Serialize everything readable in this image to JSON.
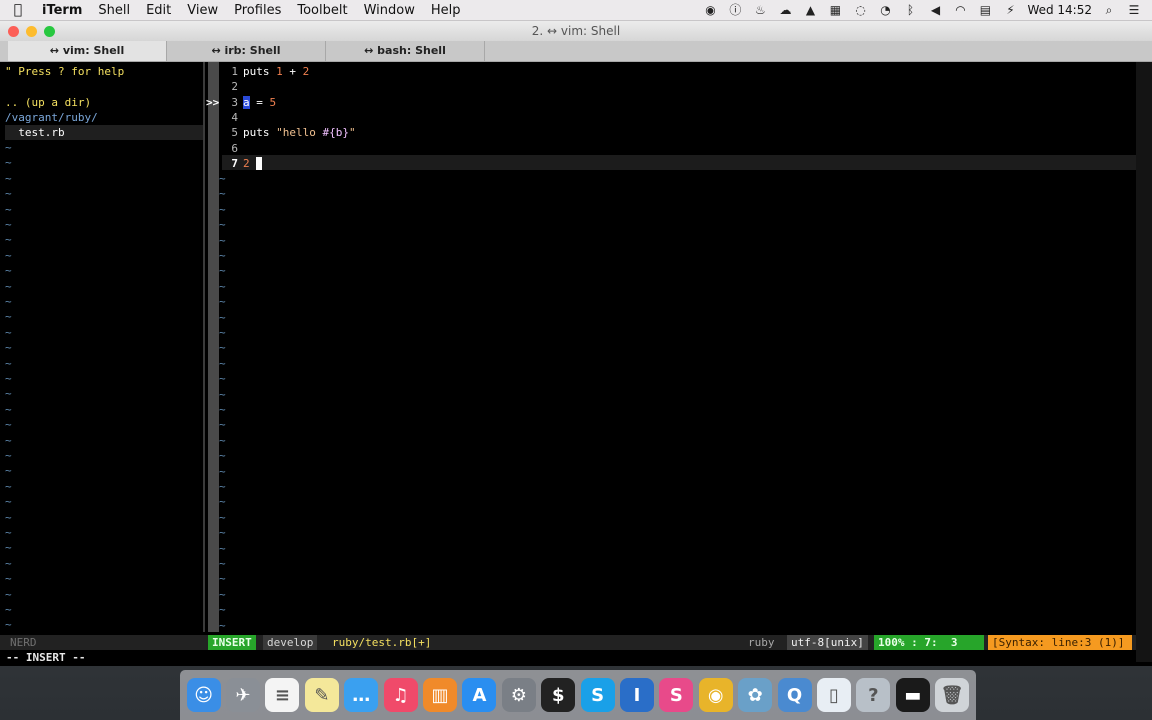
{
  "menubar": {
    "app_name": "iTerm",
    "items": [
      "Shell",
      "Edit",
      "View",
      "Profiles",
      "Toolbelt",
      "Window",
      "Help"
    ],
    "clock": "Wed 14:52",
    "battery_label": "⚡"
  },
  "window": {
    "title": "2. ↔ vim: Shell",
    "tabs": [
      {
        "label": "↔ vim: Shell"
      },
      {
        "label": "↔ irb: Shell"
      },
      {
        "label": "↔ bash: Shell"
      }
    ]
  },
  "nerdtree": {
    "help": "\" Press ? for help",
    "up": ".. (up a dir)",
    "path": "/vagrant/ruby/",
    "file": "  test.rb",
    "tilde": "~"
  },
  "editor": {
    "sign": ">>",
    "lines": [
      {
        "n": "1",
        "parts": [
          {
            "t": "puts ",
            "c": "kw"
          },
          {
            "t": "1",
            "c": "num"
          },
          {
            "t": " + ",
            "c": "kw"
          },
          {
            "t": "2",
            "c": "num"
          }
        ]
      },
      {
        "n": "2",
        "parts": []
      },
      {
        "n": "3",
        "parts": [
          {
            "t": "a",
            "c": "cur"
          },
          {
            "t": " = ",
            "c": "kw"
          },
          {
            "t": "5",
            "c": "num"
          }
        ]
      },
      {
        "n": "4",
        "parts": []
      },
      {
        "n": "5",
        "parts": [
          {
            "t": "puts ",
            "c": "kw"
          },
          {
            "t": "\"hello ",
            "c": "str"
          },
          {
            "t": "#{b}",
            "c": "interp"
          },
          {
            "t": "\"",
            "c": "str"
          }
        ]
      },
      {
        "n": "6",
        "parts": []
      },
      {
        "n": "7",
        "parts": [
          {
            "t": "2 ",
            "c": "num"
          }
        ]
      }
    ]
  },
  "statusline": {
    "nerd": "NERD",
    "mode": "INSERT",
    "branch": "develop",
    "file": "ruby/test.rb[+]",
    "filetype": "ruby",
    "encoding": "utf-8[unix]",
    "percent": "100% :",
    "position": "7:  3",
    "syntax": "[Syntax: line:3 (1)]"
  },
  "cmdline": "-- INSERT --",
  "dock": {
    "apps": [
      {
        "name": "finder",
        "glyph": "☺",
        "color": "#3a8ee6"
      },
      {
        "name": "launchpad",
        "glyph": "✈",
        "color": "#8a8f96"
      },
      {
        "name": "reminders",
        "glyph": "≡",
        "color": "#f4f4f4"
      },
      {
        "name": "notes",
        "glyph": "✎",
        "color": "#f4e89a"
      },
      {
        "name": "messages",
        "glyph": "…",
        "color": "#3aa0f0"
      },
      {
        "name": "itunes",
        "glyph": "♫",
        "color": "#f04a6a"
      },
      {
        "name": "ibooks",
        "glyph": "▥",
        "color": "#f08a2a"
      },
      {
        "name": "app-store",
        "glyph": "A",
        "color": "#2a8ef0"
      },
      {
        "name": "system-preferences",
        "glyph": "⚙",
        "color": "#7a7f86"
      },
      {
        "name": "terminal",
        "glyph": "$",
        "color": "#222222"
      },
      {
        "name": "skype",
        "glyph": "S",
        "color": "#1aa0e8"
      },
      {
        "name": "1password",
        "glyph": "I",
        "color": "#2a6ec8"
      },
      {
        "name": "scrivener",
        "glyph": "S",
        "color": "#e84a8a"
      },
      {
        "name": "chrome",
        "glyph": "◉",
        "color": "#e8b42a"
      },
      {
        "name": "preview",
        "glyph": "✿",
        "color": "#6aa0c8"
      },
      {
        "name": "quicktime",
        "glyph": "Q",
        "color": "#4a8ad0"
      },
      {
        "name": "document",
        "glyph": "▯",
        "color": "#e8eef4"
      },
      {
        "name": "help",
        "glyph": "?",
        "color": "#b8c0c8"
      },
      {
        "name": "terminal-window",
        "glyph": "▬",
        "color": "#1a1a1a"
      },
      {
        "name": "trash",
        "glyph": "🗑",
        "color": "#d0d4d8"
      }
    ]
  }
}
